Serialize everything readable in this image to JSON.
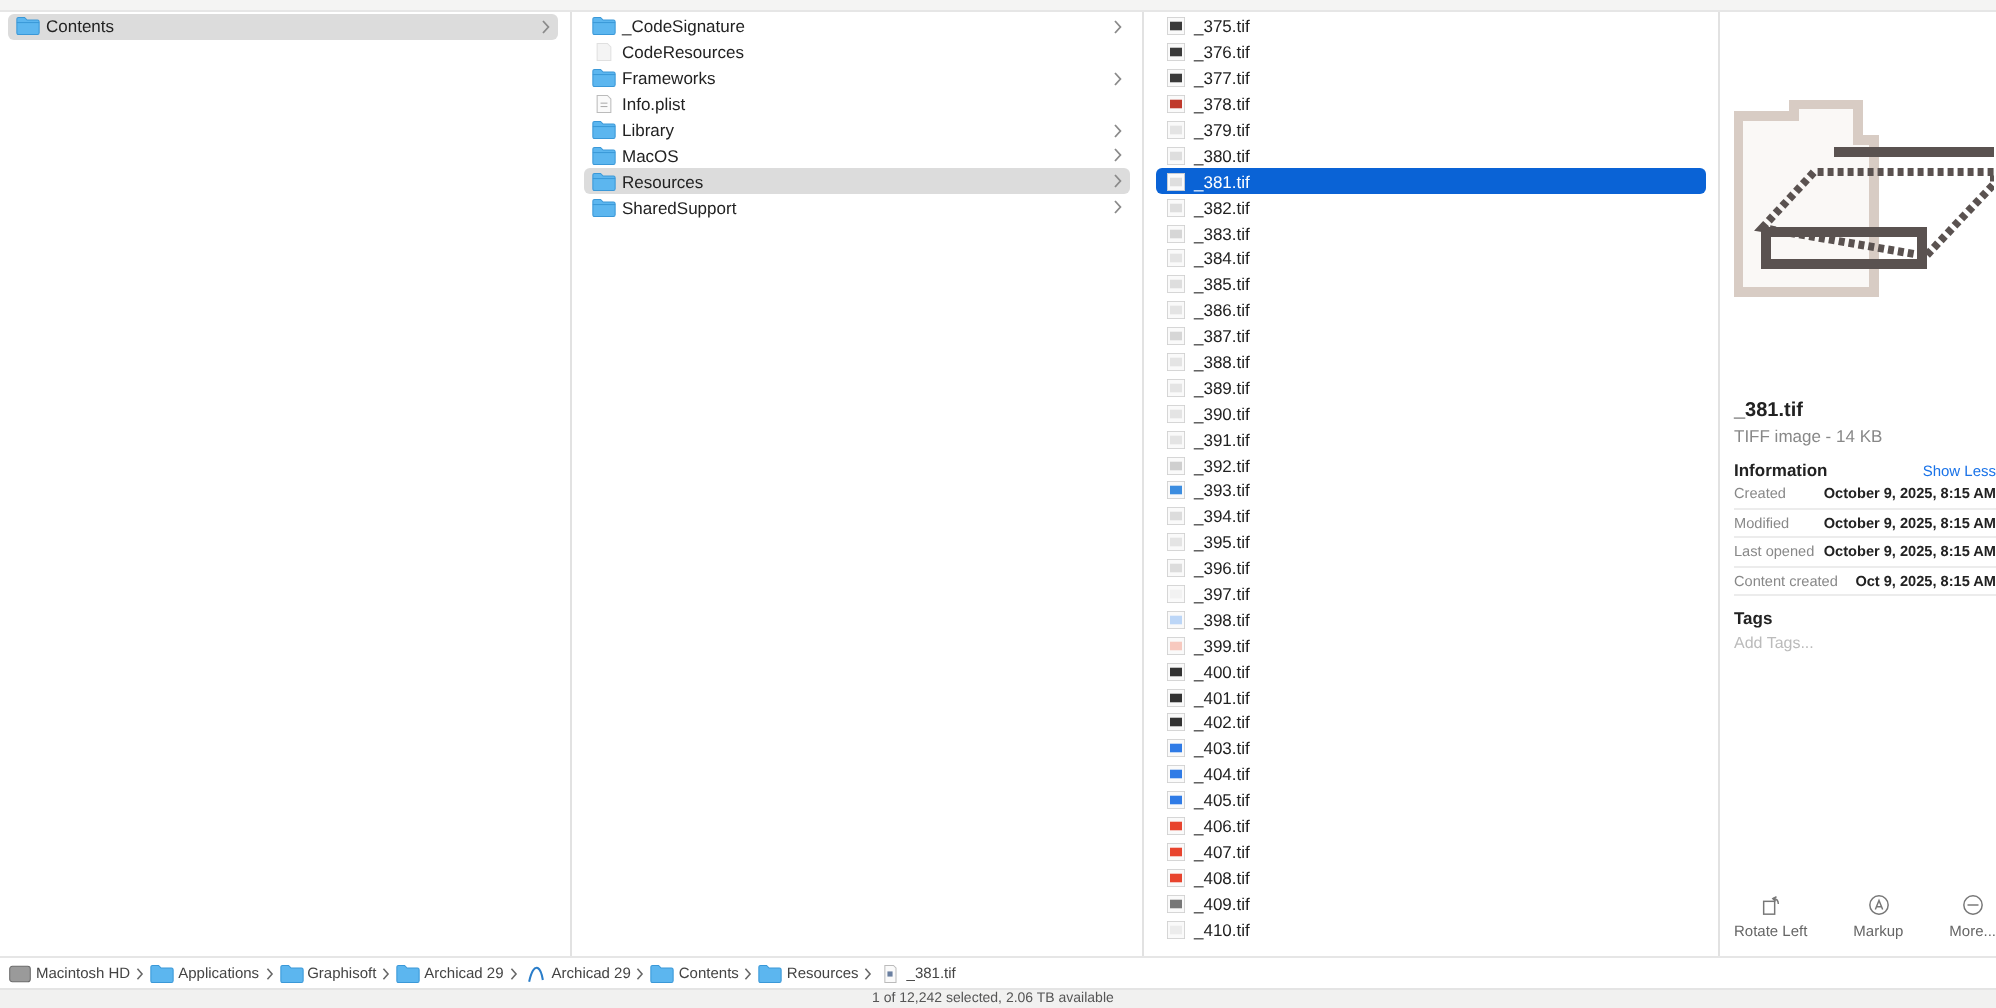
{
  "columns": [
    {
      "items": [
        {
          "name": "Contents",
          "kind": "folder",
          "arrow": true,
          "selected": true
        }
      ]
    },
    {
      "items": [
        {
          "name": "_CodeSignature",
          "kind": "folder",
          "arrow": true,
          "selected": false
        },
        {
          "name": "CodeResources",
          "kind": "file",
          "arrow": false,
          "selected": false
        },
        {
          "name": "Frameworks",
          "kind": "folder",
          "arrow": true,
          "selected": false
        },
        {
          "name": "Info.plist",
          "kind": "plist",
          "arrow": false,
          "selected": false
        },
        {
          "name": "Library",
          "kind": "folder",
          "arrow": true,
          "selected": false
        },
        {
          "name": "MacOS",
          "kind": "folder",
          "arrow": true,
          "selected": false
        },
        {
          "name": "Resources",
          "kind": "folder",
          "arrow": true,
          "selected": true
        },
        {
          "name": "SharedSupport",
          "kind": "folder",
          "arrow": true,
          "selected": false
        }
      ]
    }
  ],
  "files": [
    {
      "name": "_375.tif",
      "color": "#3a3a3a",
      "selected": false
    },
    {
      "name": "_376.tif",
      "color": "#3a3a3a",
      "selected": false
    },
    {
      "name": "_377.tif",
      "color": "#3a3a3a",
      "selected": false
    },
    {
      "name": "_378.tif",
      "color": "#c0392b",
      "selected": false
    },
    {
      "name": "_379.tif",
      "color": "#e4e4e4",
      "selected": false
    },
    {
      "name": "_380.tif",
      "color": "#dedede",
      "selected": false
    },
    {
      "name": "_381.tif",
      "color": "#dedede",
      "selected": true
    },
    {
      "name": "_382.tif",
      "color": "#dedede",
      "selected": false
    },
    {
      "name": "_383.tif",
      "color": "#d6d6d6",
      "selected": false
    },
    {
      "name": "_384.tif",
      "color": "#e4e4e4",
      "selected": false
    },
    {
      "name": "_385.tif",
      "color": "#dedede",
      "selected": false
    },
    {
      "name": "_386.tif",
      "color": "#e4e4e4",
      "selected": false
    },
    {
      "name": "_387.tif",
      "color": "#d6d6d6",
      "selected": false
    },
    {
      "name": "_388.tif",
      "color": "#e4e4e4",
      "selected": false
    },
    {
      "name": "_389.tif",
      "color": "#e4e4e4",
      "selected": false
    },
    {
      "name": "_390.tif",
      "color": "#e4e4e4",
      "selected": false
    },
    {
      "name": "_391.tif",
      "color": "#e4e4e4",
      "selected": false
    },
    {
      "name": "_392.tif",
      "color": "#cfcfcf",
      "selected": false
    },
    {
      "name": "_393.tif",
      "color": "#3c8de0",
      "selected": false
    },
    {
      "name": "_394.tif",
      "color": "#dcdcdc",
      "selected": false
    },
    {
      "name": "_395.tif",
      "color": "#e4e4e4",
      "selected": false
    },
    {
      "name": "_396.tif",
      "color": "#dcdcdc",
      "selected": false
    },
    {
      "name": "_397.tif",
      "color": "#f2f2f2",
      "selected": false
    },
    {
      "name": "_398.tif",
      "color": "#bcd6f7",
      "selected": false
    },
    {
      "name": "_399.tif",
      "color": "#f7c9bf",
      "selected": false
    },
    {
      "name": "_400.tif",
      "color": "#333333",
      "selected": false
    },
    {
      "name": "_401.tif",
      "color": "#333333",
      "selected": false
    },
    {
      "name": "_402.tif",
      "color": "#333333",
      "selected": false
    },
    {
      "name": "_403.tif",
      "color": "#2f7be6",
      "selected": false
    },
    {
      "name": "_404.tif",
      "color": "#2f7be6",
      "selected": false
    },
    {
      "name": "_405.tif",
      "color": "#2f7be6",
      "selected": false
    },
    {
      "name": "_406.tif",
      "color": "#e8442e",
      "selected": false
    },
    {
      "name": "_407.tif",
      "color": "#e8442e",
      "selected": false
    },
    {
      "name": "_408.tif",
      "color": "#e8442e",
      "selected": false
    },
    {
      "name": "_409.tif",
      "color": "#777777",
      "selected": false
    },
    {
      "name": "_410.tif",
      "color": "#ececec",
      "selected": false
    }
  ],
  "preview": {
    "name": "_381.tif",
    "subtitle": "TIFF image - 14 KB",
    "info_title": "Information",
    "toggle": "Show Less",
    "info": [
      {
        "label": "Created",
        "value": "October 9, 2025, 8:15 AM"
      },
      {
        "label": "Modified",
        "value": "October 9, 2025, 8:15 AM"
      },
      {
        "label": "Last opened",
        "value": "October 9, 2025, 8:15 AM"
      },
      {
        "label": "Content created",
        "value": "Oct 9, 2025, 8:15 AM"
      }
    ],
    "tags_title": "Tags",
    "tags_placeholder": "Add Tags...",
    "actions": [
      {
        "kind": "rotate",
        "label": "Rotate Left"
      },
      {
        "kind": "markup",
        "label": "Markup"
      },
      {
        "kind": "more",
        "label": "More..."
      }
    ]
  },
  "path_bar": [
    {
      "kind": "disk",
      "label": "Macintosh HD"
    },
    {
      "kind": "folder",
      "label": "Applications"
    },
    {
      "kind": "folder",
      "label": "Graphisoft"
    },
    {
      "kind": "folder",
      "label": "Archicad 29"
    },
    {
      "kind": "app",
      "label": "Archicad 29"
    },
    {
      "kind": "folder",
      "label": "Contents"
    },
    {
      "kind": "folder",
      "label": "Resources"
    },
    {
      "kind": "file",
      "label": "_381.tif"
    }
  ],
  "status_bar": "1 of 12,242 selected, 2.06 TB available"
}
